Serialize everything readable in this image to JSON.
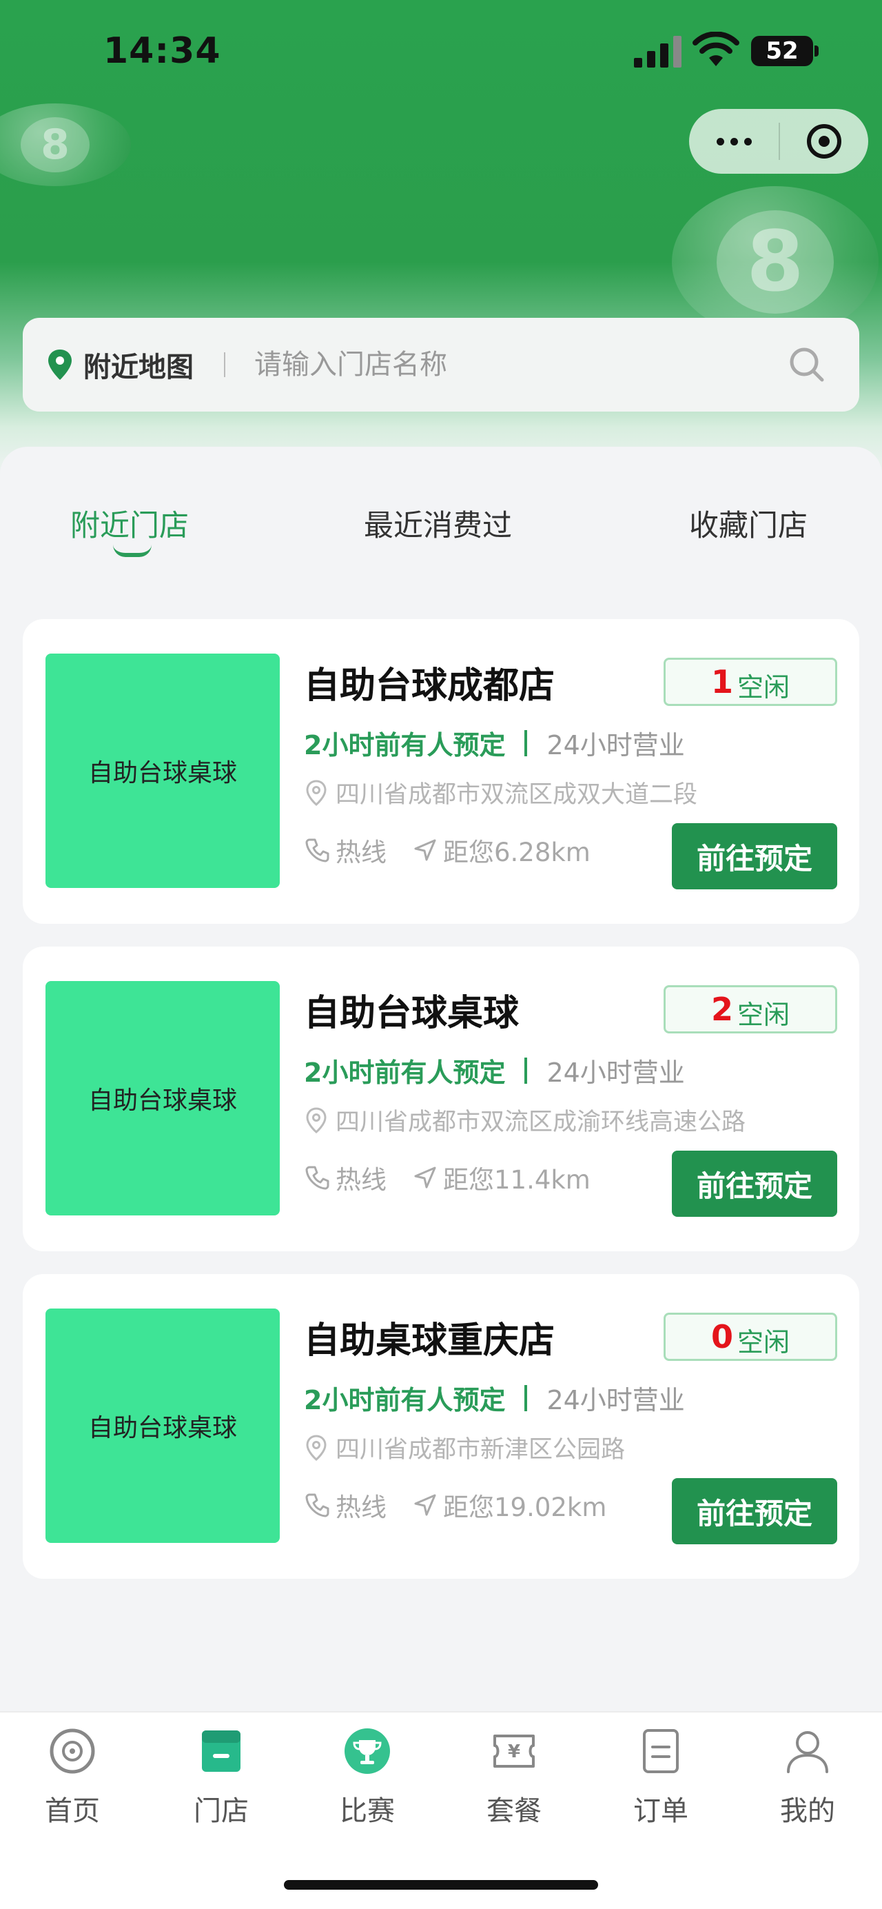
{
  "status_bar": {
    "time": "14:34",
    "battery": "52"
  },
  "search": {
    "map_label": "附近地图",
    "placeholder": "请输入门店名称"
  },
  "tabs": [
    {
      "label": "附近门店",
      "active": true
    },
    {
      "label": "最近消费过",
      "active": false
    },
    {
      "label": "收藏门店",
      "active": false
    }
  ],
  "stores": [
    {
      "thumb_text": "自助台球桌球",
      "name": "自助台球成都店",
      "free_count": "1",
      "free_label": "空闲",
      "booked": "2小时前有人预定",
      "hours": "24小时营业",
      "address": "四川省成都市双流区成双大道二段",
      "hotline": "热线",
      "distance": "距您6.28km",
      "button": "前往预定"
    },
    {
      "thumb_text": "自助台球桌球",
      "name": "自助台球桌球",
      "free_count": "2",
      "free_label": "空闲",
      "booked": "2小时前有人预定",
      "hours": "24小时营业",
      "address": "四川省成都市双流区成渝环线高速公路",
      "hotline": "热线",
      "distance": "距您11.4km",
      "button": "前往预定"
    },
    {
      "thumb_text": "自助台球桌球",
      "name": "自助桌球重庆店",
      "free_count": "0",
      "free_label": "空闲",
      "booked": "2小时前有人预定",
      "hours": "24小时营业",
      "address": "四川省成都市新津区公园路",
      "hotline": "热线",
      "distance": "距您19.02km",
      "button": "前往预定"
    }
  ],
  "tabbar": [
    {
      "label": "首页",
      "icon": "billiard-ball-icon"
    },
    {
      "label": "门店",
      "icon": "store-icon",
      "active": true
    },
    {
      "label": "比赛",
      "icon": "trophy-icon"
    },
    {
      "label": "套餐",
      "icon": "ticket-icon"
    },
    {
      "label": "订单",
      "icon": "order-list-icon"
    },
    {
      "label": "我的",
      "icon": "user-icon"
    }
  ],
  "colors": {
    "brand_green": "#22924f",
    "accent_green": "#2a9c59",
    "free_red": "#e4141b",
    "thumb_green": "#3ee496"
  }
}
